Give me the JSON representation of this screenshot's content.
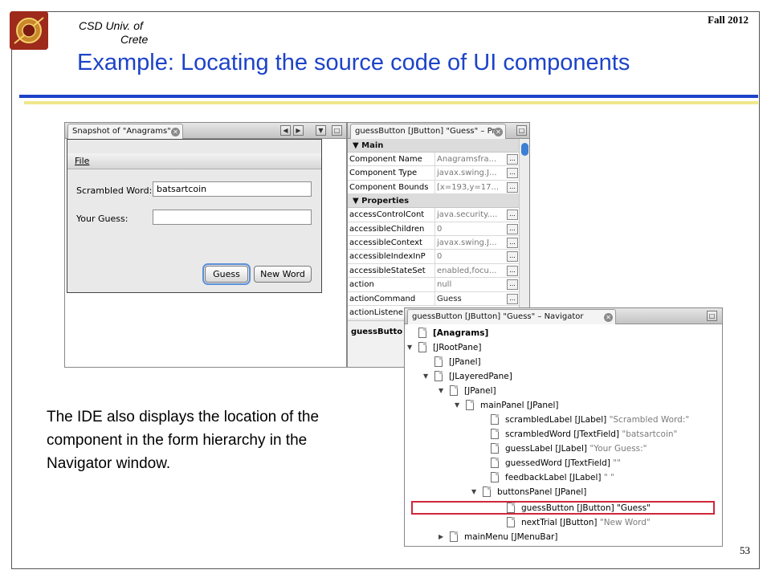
{
  "header": {
    "university_line1": "CSD Univ. of",
    "university_line2": "Crete",
    "term": "Fall 2012",
    "title": "Example: Locating the source code of UI components"
  },
  "body_text": "The IDE also displays the location of the component in the form hierarchy in the Navigator window.",
  "page_number": "53",
  "snapshot_window": {
    "tab_title": "Snapshot of \"Anagrams\"",
    "menu_file": "File",
    "scrambled_label": "Scrambled Word:",
    "scrambled_value": "batsartcoin",
    "guess_label": "Your Guess:",
    "guess_value": "",
    "guess_button": "Guess",
    "new_word_button": "New Word"
  },
  "properties_window": {
    "tab_title": "guessButton [JButton] \"Guess\" – Pr...",
    "section_main": "Main",
    "section_properties": "Properties",
    "main_rows": [
      {
        "key": "Component Name",
        "value": "Anagramsfra..."
      },
      {
        "key": "Component Type",
        "value": "javax.swing.J..."
      },
      {
        "key": "Component Bounds",
        "value": "[x=193,y=17..."
      }
    ],
    "prop_rows": [
      {
        "key": "accessControlCont",
        "value": "java.security...."
      },
      {
        "key": "accessibleChildren",
        "value": "0"
      },
      {
        "key": "accessibleContext",
        "value": "javax.swing.J..."
      },
      {
        "key": "accessibleIndexInP",
        "value": "0"
      },
      {
        "key": "accessibleStateSet",
        "value": "enabled,focu..."
      },
      {
        "key": "action",
        "value": "null"
      },
      {
        "key": "actionCommand",
        "value": "Guess"
      },
      {
        "key": "actionListene",
        "value": ""
      }
    ],
    "footer_text": "guessButto"
  },
  "navigator_window": {
    "tab_title": "guessButton [JButton] \"Guess\" – Navigator",
    "nodes": [
      {
        "name": "[Anagrams]",
        "extra": ""
      },
      {
        "name": "[JRootPane]",
        "extra": ""
      },
      {
        "name": "[JPanel]",
        "extra": ""
      },
      {
        "name": "[JLayeredPane]",
        "extra": ""
      },
      {
        "name": "[JPanel]",
        "extra": ""
      },
      {
        "name": "mainPanel [JPanel]",
        "extra": ""
      },
      {
        "name": "scrambledLabel [JLabel]",
        "extra": "\"Scrambled Word:\""
      },
      {
        "name": "scrambledWord [JTextField]",
        "extra": "\"batsartcoin\""
      },
      {
        "name": "guessLabel [JLabel]",
        "extra": "\"Your Guess:\""
      },
      {
        "name": "guessedWord [JTextField]",
        "extra": "\"\""
      },
      {
        "name": "feedbackLabel [JLabel]",
        "extra": "\" \""
      },
      {
        "name": "buttonsPanel [JPanel]",
        "extra": ""
      },
      {
        "name": "guessButton [JButton]",
        "extra": "\"Guess\""
      },
      {
        "name": "nextTrial [JButton]",
        "extra": "\"New Word\""
      },
      {
        "name": "mainMenu [JMenuBar]",
        "extra": ""
      }
    ]
  },
  "colors": {
    "title_blue": "#1d43c8",
    "rule_yellow": "#f0e68c",
    "highlight_red": "#d0273c"
  }
}
